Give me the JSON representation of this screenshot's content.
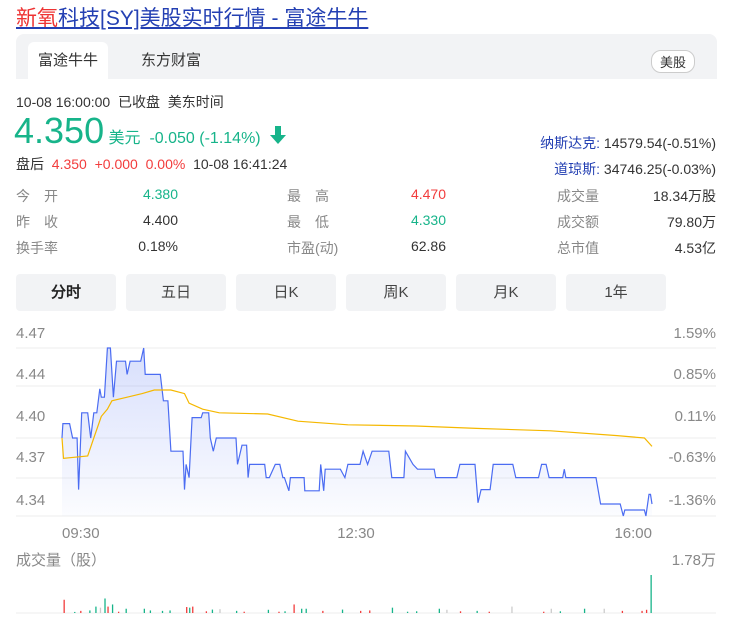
{
  "title": {
    "highlight": "新氧",
    "rest": "科技[SY]美股实时行情 - 富途牛牛"
  },
  "tabs": [
    "富途牛牛",
    "东方财富"
  ],
  "market_badge": "美股",
  "status": {
    "time": "10-08 16:00:00",
    "state": "已收盘",
    "tz": "美东时间"
  },
  "quote": {
    "price": "4.350",
    "currency": "美元",
    "change": "-0.050 (-1.14%)",
    "direction_icon": "arrow-down-icon"
  },
  "after_hours": {
    "label": "盘后",
    "price": "4.350",
    "change": "+0.000",
    "pct": "0.00%",
    "time": "10-08 16:41:24"
  },
  "indices": [
    {
      "name": "纳斯达克:",
      "value": "14579.54(-0.51%)"
    },
    {
      "name": "道琼斯:",
      "value": "34746.25(-0.03%)"
    }
  ],
  "stats": [
    [
      {
        "label": "今　开",
        "value": "4.380",
        "color": "green"
      },
      {
        "label": "最　高",
        "value": "4.470",
        "color": "red"
      },
      {
        "label": "成交量",
        "value": "18.34万股",
        "color": ""
      }
    ],
    [
      {
        "label": "昨　收",
        "value": "4.400",
        "color": ""
      },
      {
        "label": "最　低",
        "value": "4.330",
        "color": "green"
      },
      {
        "label": "成交额",
        "value": "79.80万",
        "color": ""
      }
    ],
    [
      {
        "label": "换手率",
        "value": "0.18%",
        "color": ""
      },
      {
        "label": "市盈(动)",
        "value": "62.86",
        "color": ""
      },
      {
        "label": "总市值",
        "value": "4.53亿",
        "color": ""
      }
    ]
  ],
  "periods": [
    "分时",
    "五日",
    "日K",
    "周K",
    "月K",
    "1年"
  ],
  "chart_data": {
    "type": "line",
    "y_left_ticks": [
      "4.47",
      "4.44",
      "4.40",
      "4.37",
      "4.34"
    ],
    "y_right_ticks": [
      "1.59%",
      "0.85%",
      "0.11%",
      "-0.63%",
      "-1.36%"
    ],
    "x_ticks": [
      "09:30",
      "12:30",
      "16:00"
    ],
    "ylim": [
      4.33,
      4.47
    ],
    "xlim_minutes": [
      0,
      390
    ],
    "price": [
      [
        0,
        4.395
      ],
      [
        0.6,
        4.407
      ],
      [
        5,
        4.407
      ],
      [
        7,
        4.395
      ],
      [
        10,
        4.395
      ],
      [
        11,
        4.352
      ],
      [
        13,
        4.416
      ],
      [
        17,
        4.416
      ],
      [
        19,
        4.395
      ],
      [
        21,
        4.416
      ],
      [
        23,
        4.416
      ],
      [
        25,
        4.436
      ],
      [
        26,
        4.429
      ],
      [
        28,
        4.429
      ],
      [
        30,
        4.47
      ],
      [
        32,
        4.47
      ],
      [
        34,
        4.429
      ],
      [
        36,
        4.459
      ],
      [
        42,
        4.459
      ],
      [
        43,
        4.448
      ],
      [
        45,
        4.459
      ],
      [
        52,
        4.459
      ],
      [
        54,
        4.47
      ],
      [
        55,
        4.448
      ],
      [
        58,
        4.448
      ],
      [
        65,
        4.448
      ],
      [
        67,
        4.426
      ],
      [
        70,
        4.426
      ],
      [
        72,
        4.384
      ],
      [
        80,
        4.384
      ],
      [
        81,
        4.352
      ],
      [
        82,
        4.373
      ],
      [
        84,
        4.362
      ],
      [
        86,
        4.412
      ],
      [
        92,
        4.412
      ],
      [
        93,
        4.416
      ],
      [
        97,
        4.416
      ],
      [
        98,
        4.395
      ],
      [
        100,
        4.384
      ],
      [
        102,
        4.395
      ],
      [
        115,
        4.395
      ],
      [
        116,
        4.373
      ],
      [
        119,
        4.389
      ],
      [
        122,
        4.389
      ],
      [
        123,
        4.362
      ],
      [
        124,
        4.373
      ],
      [
        134,
        4.373
      ],
      [
        135,
        4.362
      ],
      [
        137,
        4.362
      ],
      [
        141,
        4.373
      ],
      [
        144,
        4.373
      ],
      [
        146,
        4.362
      ],
      [
        147,
        4.362
      ],
      [
        150,
        4.351
      ],
      [
        151,
        4.362
      ],
      [
        160,
        4.362
      ],
      [
        160.5,
        4.351
      ],
      [
        170,
        4.351
      ],
      [
        171,
        4.373
      ],
      [
        173,
        4.351
      ],
      [
        174,
        4.369
      ],
      [
        184,
        4.369
      ],
      [
        187,
        4.362
      ],
      [
        189,
        4.373
      ],
      [
        197,
        4.373
      ],
      [
        199,
        4.384
      ],
      [
        202,
        4.373
      ],
      [
        205,
        4.384
      ],
      [
        216,
        4.384
      ],
      [
        218,
        4.362
      ],
      [
        226,
        4.362
      ],
      [
        227,
        4.384
      ],
      [
        232,
        4.373
      ],
      [
        235,
        4.369
      ],
      [
        246,
        4.369
      ],
      [
        247,
        4.362
      ],
      [
        261,
        4.362
      ],
      [
        263,
        4.373
      ],
      [
        273,
        4.373
      ],
      [
        275,
        4.341
      ],
      [
        277,
        4.352
      ],
      [
        283,
        4.352
      ],
      [
        285,
        4.373
      ],
      [
        298,
        4.373
      ],
      [
        300,
        4.362
      ],
      [
        315,
        4.362
      ],
      [
        317,
        4.373
      ],
      [
        320,
        4.373
      ],
      [
        322,
        4.362
      ],
      [
        331,
        4.362
      ],
      [
        332,
        4.369
      ],
      [
        333,
        4.362
      ],
      [
        353,
        4.362
      ],
      [
        356,
        4.34
      ],
      [
        369,
        4.34
      ],
      [
        371,
        4.33
      ],
      [
        372,
        4.335
      ],
      [
        385,
        4.335
      ],
      [
        386,
        4.33
      ],
      [
        388,
        4.348
      ],
      [
        389,
        4.348
      ],
      [
        390,
        4.34
      ]
    ],
    "avg": [
      [
        0,
        4.395
      ],
      [
        1,
        4.378
      ],
      [
        17,
        4.38
      ],
      [
        21,
        4.395
      ],
      [
        26,
        4.413
      ],
      [
        30,
        4.419
      ],
      [
        33,
        4.426
      ],
      [
        43,
        4.429
      ],
      [
        53,
        4.432
      ],
      [
        61,
        4.435
      ],
      [
        72,
        4.435
      ],
      [
        81,
        4.432
      ],
      [
        84,
        4.424
      ],
      [
        93,
        4.419
      ],
      [
        104,
        4.416
      ],
      [
        136,
        4.415
      ],
      [
        156,
        4.409
      ],
      [
        189,
        4.406
      ],
      [
        234,
        4.405
      ],
      [
        274,
        4.403
      ],
      [
        323,
        4.401
      ],
      [
        367,
        4.397
      ],
      [
        385,
        4.395
      ],
      [
        390,
        4.388
      ]
    ],
    "volume_label": "成交量（股）",
    "volume_max_label": "1.78万",
    "volume_max": 1.78,
    "volume": [
      [
        1,
        0.62,
        "r"
      ],
      [
        8,
        0.05,
        "g"
      ],
      [
        12,
        0.1,
        "r"
      ],
      [
        18,
        0.12,
        "g"
      ],
      [
        22,
        0.3,
        "g"
      ],
      [
        25,
        0.25,
        "n"
      ],
      [
        28,
        0.68,
        "g"
      ],
      [
        30,
        0.3,
        "r"
      ],
      [
        33,
        0.4,
        "g"
      ],
      [
        37,
        0.06,
        "r"
      ],
      [
        42,
        0.2,
        "g"
      ],
      [
        54,
        0.2,
        "g"
      ],
      [
        58,
        0.12,
        "g"
      ],
      [
        66,
        0.1,
        "g"
      ],
      [
        71,
        0.12,
        "g"
      ],
      [
        82,
        0.28,
        "r"
      ],
      [
        84,
        0.25,
        "g"
      ],
      [
        86,
        0.3,
        "r"
      ],
      [
        95,
        0.08,
        "r"
      ],
      [
        99,
        0.16,
        "g"
      ],
      [
        104,
        0.18,
        "n"
      ],
      [
        115,
        0.1,
        "g"
      ],
      [
        120,
        0.06,
        "r"
      ],
      [
        136,
        0.15,
        "g"
      ],
      [
        143,
        0.06,
        "r"
      ],
      [
        147,
        0.08,
        "g"
      ],
      [
        153,
        0.4,
        "r"
      ],
      [
        158,
        0.2,
        "g"
      ],
      [
        161,
        0.2,
        "g"
      ],
      [
        172,
        0.1,
        "r"
      ],
      [
        185,
        0.16,
        "g"
      ],
      [
        197,
        0.1,
        "r"
      ],
      [
        203,
        0.12,
        "r"
      ],
      [
        218,
        0.25,
        "g"
      ],
      [
        228,
        0.06,
        "g"
      ],
      [
        234,
        0.08,
        "g"
      ],
      [
        249,
        0.2,
        "g"
      ],
      [
        254,
        0.15,
        "n"
      ],
      [
        263,
        0.08,
        "r"
      ],
      [
        274,
        0.1,
        "g"
      ],
      [
        282,
        0.06,
        "r"
      ],
      [
        297,
        0.3,
        "n"
      ],
      [
        318,
        0.06,
        "r"
      ],
      [
        323,
        0.2,
        "n"
      ],
      [
        329,
        0.08,
        "g"
      ],
      [
        345,
        0.2,
        "g"
      ],
      [
        358,
        0.2,
        "n"
      ],
      [
        370,
        0.1,
        "r"
      ],
      [
        383,
        0.1,
        "r"
      ],
      [
        386,
        0.15,
        "r"
      ],
      [
        389,
        1.78,
        "g"
      ]
    ],
    "colors": {
      "price": "#4b6cf2",
      "avg": "#f5b800",
      "up": "#f23c3c",
      "down": "#17b48a",
      "neutral": "#cccccc"
    }
  }
}
